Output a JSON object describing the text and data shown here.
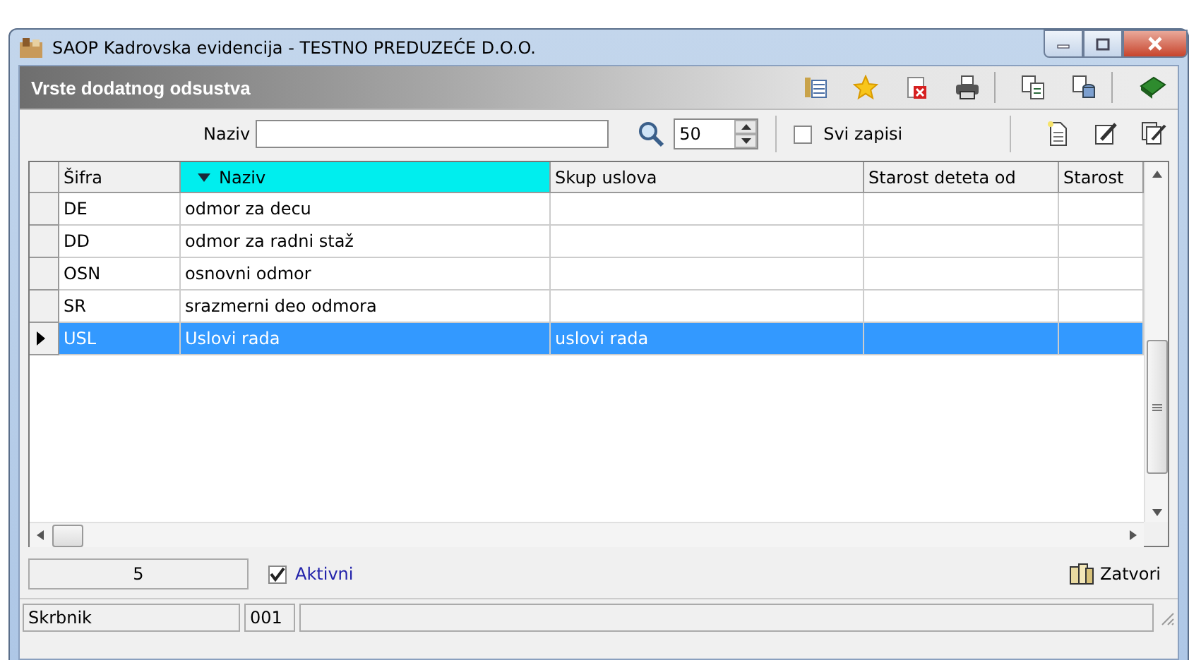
{
  "window": {
    "title": "SAOP Kadrovska evidencija - TESTNO PREDUZEĆE D.O.O."
  },
  "header": {
    "title": "Vrste dodatnog odsustva"
  },
  "search": {
    "label": "Naziv"
  },
  "page_size": {
    "value": "50"
  },
  "all_records": {
    "label": "Svi zapisi",
    "checked": false
  },
  "table": {
    "columns": [
      {
        "label": "Šifra",
        "sorted": false
      },
      {
        "label": "Naziv",
        "sorted": true
      },
      {
        "label": "Skup uslova",
        "sorted": false
      },
      {
        "label": "Starost deteta od",
        "sorted": false
      },
      {
        "label": "Starost",
        "sorted": false
      }
    ],
    "rows": [
      {
        "cells": [
          "DE",
          "odmor za decu"
        ],
        "selected": false
      },
      {
        "cells": [
          "DD",
          "odmor za radni staž"
        ],
        "selected": false
      },
      {
        "cells": [
          "OSN",
          "osnovni odmor"
        ],
        "selected": false
      },
      {
        "cells": [
          "SR",
          "srazmerni deo odmora"
        ],
        "selected": false
      },
      {
        "cells": [
          "USL",
          "Uslovi rada",
          "uslovi rada"
        ],
        "selected": true
      }
    ]
  },
  "footer": {
    "count": "5",
    "active": {
      "label": "Aktivni",
      "checked": true
    },
    "close_button": "Zatvori"
  },
  "status_bar": [
    "Skrbnik",
    "001"
  ]
}
